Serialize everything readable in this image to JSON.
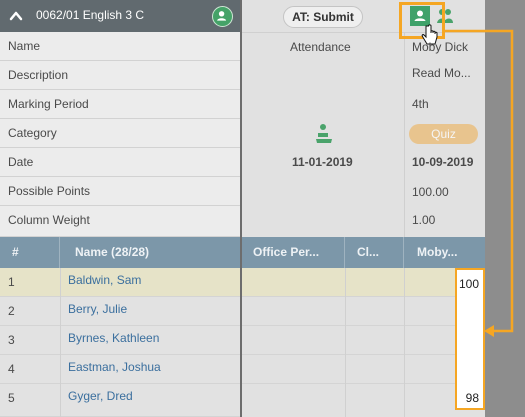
{
  "header": {
    "class_title": "0062/01 English 3 C"
  },
  "properties": [
    {
      "label": "Name"
    },
    {
      "label": "Description"
    },
    {
      "label": "Marking Period"
    },
    {
      "label": "Category"
    },
    {
      "label": "Date"
    },
    {
      "label": "Possible Points"
    },
    {
      "label": "Column Weight"
    }
  ],
  "columns": {
    "num": "#",
    "name": "Name (28/28)",
    "office": "Office Per...",
    "cl": "Cl...",
    "moby": "Moby..."
  },
  "attendance": {
    "submit_label": "AT: Submit",
    "name": "Attendance",
    "date": "11-01-2019"
  },
  "assignment": {
    "name": "Moby Dick",
    "description": "Read Mo...",
    "marking_period": "4th",
    "category": "Quiz",
    "date": "10-09-2019",
    "possible_points": "100.00",
    "column_weight": "1.00"
  },
  "students": [
    {
      "num": "1",
      "name": "Baldwin, Sam",
      "score": "100"
    },
    {
      "num": "2",
      "name": "Berry, Julie",
      "score": ""
    },
    {
      "num": "3",
      "name": "Byrnes, Kathleen",
      "score": ""
    },
    {
      "num": "4",
      "name": "Eastman, Joshua",
      "score": ""
    },
    {
      "num": "5",
      "name": "Gyger, Dred",
      "score": "98"
    }
  ],
  "colors": {
    "accent": "#f5a623",
    "header_bar": "#7c97a9",
    "avatar_green": "#3fa26a",
    "row_highlight": "#e6e3c8"
  }
}
